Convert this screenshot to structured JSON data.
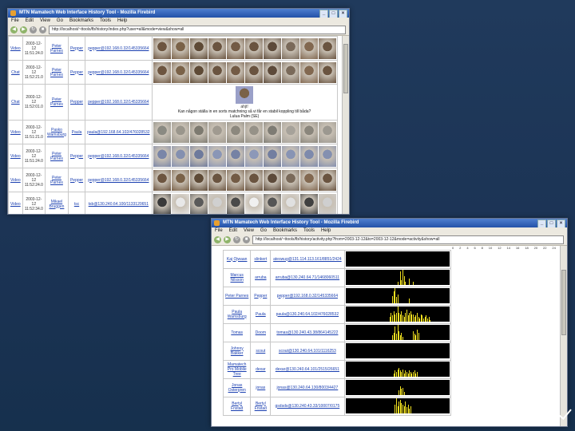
{
  "window1": {
    "title": "MTN Mamatech Web Interface History Tool - Mozilla Firebird",
    "menu": [
      "File",
      "Edit",
      "View",
      "Go",
      "Bookmarks",
      "Tools",
      "Help"
    ],
    "url": "http://localhost/~ttools/fb/history/index.php?user=all&mode=view&show=all",
    "rows": [
      {
        "type": "Video",
        "date": "2003-12-12 11:51:24.0",
        "user": "Peter Parnes",
        "host": "Pepper",
        "session": "pepper@192.168.0.32/145335664",
        "media": "thumbs",
        "thumb_colors": [
          "#6d5540",
          "#7a6248",
          "#5e4a36",
          "#6a5440",
          "#735b45",
          "#6a5440",
          "#5d4a3a",
          "#7a6a5a",
          "#826850",
          "#6a5440"
        ]
      },
      {
        "type": "Chat",
        "date": "2003-12-12 11:52:21.0",
        "user": "Peter Parnes",
        "host": "Pepper",
        "session": "pepper@192.168.0.32/145335664",
        "media": "thumbs",
        "thumb_colors": [
          "#6d5540",
          "#7a6248",
          "#5e4a36",
          "#6a5440",
          "#735b45",
          "#6a5440",
          "#5d4a3a",
          "#7a6a5a",
          "#826850",
          "#6a5440"
        ]
      },
      {
        "type": "Chat",
        "date": "2003-12-12 11:52:01.0",
        "user": "Peter Parnes",
        "host": "Pepper",
        "session": "pepper@192.168.0.32/145335664",
        "media": "chat",
        "chat_header": "ahjt!",
        "chat_text": "Kan någon ställa in en sorts matchning så vi får en stabil koppling till båda? Lulua Palm (SE)"
      },
      {
        "type": "Video",
        "date": "2003-12-12 11:51:21.0",
        "user": "Pasko Wamsburg",
        "host": "Paula",
        "session": "paula@192.168.64.102/476028532",
        "media": "thumbs",
        "thumb_colors": [
          "#8a8a82",
          "#9a968c",
          "#7d7a70",
          "#a09a90",
          "#8c887e",
          "#969288",
          "#7e7c74",
          "#a6a29a",
          "#8a867c",
          "#9c9890"
        ]
      },
      {
        "type": "Video",
        "date": "2003-12-12 11:51:24.0",
        "user": "Peter Parnes",
        "host": "Pepper",
        "session": "pepper@192.168.0.32/145335664",
        "media": "thumbs",
        "thumb_colors": [
          "#7a86a8",
          "#8490b0",
          "#6e7a9c",
          "#8a96b6",
          "#7682a4",
          "#8c98b8",
          "#727ea0",
          "#8894b4",
          "#7e8aac",
          "#8490b0"
        ]
      },
      {
        "type": "Video",
        "date": "2003-12-12 11:52:24.0",
        "user": "Peter Parnes",
        "host": "Pepper",
        "session": "pepper@192.168.0.32/145335664",
        "media": "thumbs",
        "thumb_colors": [
          "#6d5540",
          "#7a6248",
          "#5e4a36",
          "#6a5440",
          "#735b45",
          "#6a5440",
          "#5d4a3a",
          "#7a6a5a",
          "#826850",
          "#6a5440"
        ]
      },
      {
        "type": "Video",
        "date": "2003-12-12 11:52:34.0",
        "user": "Mikael Bruggen",
        "host": "tsc",
        "session": "tsb@130.240.64.100/1133120651",
        "media": "thumbs",
        "thumb_colors": [
          "#3a3a3a",
          "#e8e8e8",
          "#5a5a5a",
          "#d0d0d0",
          "#4a4a4a",
          "#f0f0f0",
          "#555555",
          "#e0e0e0",
          "#404040",
          "#cfcfcf"
        ]
      }
    ]
  },
  "window2": {
    "title": "MTN Mamatech Web Interface History Tool - Mozilla Firebird",
    "menu": [
      "File",
      "Edit",
      "View",
      "Go",
      "Bookmarks",
      "Tools",
      "Help"
    ],
    "url": "http://localhost/~ttools/fb/history/activity.php?from=2003-12-12&to=2003-12-12&mode=activity&show=all",
    "scale": [
      "0",
      "2",
      "4",
      "6",
      "8",
      "10",
      "12",
      "14",
      "16",
      "18",
      "20",
      "22",
      "24"
    ],
    "rows": [
      {
        "user": "Kaj Ojwaan",
        "host": "slinkert",
        "session": "ateswug@131.114.113.161/8851/2424",
        "activity": [
          0,
          0,
          0,
          0,
          0,
          0,
          0,
          0,
          0,
          0,
          0,
          0,
          0,
          0,
          0,
          0,
          0,
          0,
          0,
          0,
          0,
          0,
          0,
          0,
          0,
          0,
          0,
          0,
          0,
          0,
          0,
          0,
          0,
          0,
          0,
          0,
          0,
          0,
          0,
          0,
          0,
          0,
          0,
          0,
          0,
          0,
          0,
          0,
          0,
          0,
          0,
          0,
          0,
          0,
          0,
          0,
          0,
          0,
          0,
          0,
          0,
          0,
          0,
          0,
          0,
          0,
          0,
          0,
          0,
          0,
          0,
          0,
          0,
          0,
          0,
          0,
          0,
          0,
          0,
          0
        ]
      },
      {
        "user": "Marcus Nilsson",
        "host": "arruba",
        "session": "arruba@130.240.64.71/1468060511",
        "activity": [
          0,
          0,
          0,
          0,
          0,
          0,
          0,
          0,
          0,
          0,
          0,
          0,
          0,
          0,
          0,
          0,
          0,
          0,
          0,
          0,
          0,
          0,
          0,
          0,
          0,
          0,
          0,
          0,
          0,
          0,
          0,
          0,
          0,
          0,
          0,
          0,
          0,
          0,
          0,
          0,
          0.2,
          0,
          0.9,
          0.3,
          1,
          0.6,
          0.2,
          0,
          0,
          0.4,
          0,
          0,
          0.2,
          0,
          0,
          0,
          0,
          0,
          0,
          0,
          0,
          0,
          0,
          0,
          0,
          0,
          0,
          0,
          0,
          0,
          0,
          0,
          0,
          0,
          0,
          0,
          0,
          0,
          0,
          0
        ]
      },
      {
        "user": "Peter Parnes",
        "host": "Pepper",
        "session": "pepper@192.168.0.32/145335664",
        "activity": [
          0,
          0,
          0,
          0,
          0,
          0,
          0,
          0,
          0,
          0,
          0,
          0,
          0,
          0,
          0,
          0,
          0,
          0,
          0,
          0,
          0,
          0,
          0,
          0,
          0,
          0,
          0,
          0,
          0,
          0,
          0,
          0,
          0,
          0,
          0,
          0,
          0.5,
          0.8,
          1,
          0.4,
          0.6,
          0,
          0,
          0,
          0,
          0,
          0,
          0,
          0,
          0.3,
          0,
          0,
          0,
          0,
          0,
          0,
          0,
          0,
          0,
          0,
          0,
          0,
          0,
          0,
          0,
          0,
          0,
          0,
          0,
          0,
          0,
          0,
          0,
          0,
          0,
          0,
          0,
          0,
          0,
          0
        ]
      },
      {
        "user": "Paula Wamsburg",
        "host": "Paula",
        "session": "paula@130.240.64.102/476028532",
        "activity": [
          0,
          0,
          0,
          0,
          0,
          0,
          0,
          0,
          0,
          0,
          0,
          0,
          0,
          0,
          0,
          0,
          0,
          0,
          0,
          0,
          0,
          0,
          0,
          0,
          0,
          0,
          0,
          0,
          0,
          0,
          0,
          0,
          0,
          0,
          0.3,
          0.6,
          0.4,
          0.7,
          0.5,
          0.6,
          1,
          0.6,
          0.5,
          0.7,
          0.4,
          0.3,
          0.6,
          0.8,
          0.4,
          0.6,
          0.7,
          0.5,
          0.5,
          0.3,
          0.4,
          0.6,
          0.3,
          0.2,
          0.5,
          0.4,
          0.2,
          0.3,
          0.4,
          0.2,
          0.3,
          0.1,
          0,
          0,
          0,
          0,
          0,
          0,
          0,
          0,
          0,
          0,
          0,
          0,
          0,
          0
        ]
      },
      {
        "user": "Tomas",
        "host": "Doom",
        "session": "tomas@130.240.43.38/864145222",
        "activity": [
          0,
          0,
          0,
          0,
          0,
          0,
          0,
          0,
          0,
          0,
          0,
          0,
          0,
          0,
          0,
          0,
          0,
          0,
          0,
          0,
          0,
          0,
          0,
          0,
          0,
          0,
          0,
          0,
          0,
          0,
          0,
          0,
          0,
          0,
          0,
          0,
          0.3,
          0.5,
          0.9,
          0.4,
          1,
          0.6,
          0.3,
          0.5,
          0.2,
          0,
          0,
          0,
          0,
          0,
          0,
          0,
          0.6,
          0.4,
          0.3,
          0.7,
          0.5,
          0,
          0,
          0,
          0,
          0,
          0,
          0,
          0,
          0,
          0,
          0,
          0,
          0,
          0,
          0,
          0,
          0,
          0,
          0,
          0,
          0,
          0,
          0
        ]
      },
      {
        "user": "Johnny Bakker",
        "host": "scout",
        "session": "scout@130.240.64.101/1116253",
        "activity": [
          0,
          0,
          0,
          0,
          0,
          0,
          0,
          0,
          0,
          0,
          0,
          0,
          0,
          0,
          0,
          0,
          0,
          0,
          0,
          0,
          0,
          0,
          0,
          0,
          0,
          0,
          0,
          0,
          0,
          0,
          0,
          0,
          0,
          0,
          0,
          0,
          0,
          0,
          0,
          0,
          0,
          0,
          0,
          0,
          0,
          0,
          0,
          0,
          0,
          0,
          0,
          0,
          0,
          0,
          0,
          0,
          0,
          0,
          0,
          0,
          0,
          0,
          0,
          0,
          0,
          0,
          0,
          0,
          0,
          0,
          0,
          0,
          0,
          0,
          0,
          0,
          0,
          0,
          0,
          0
        ]
      },
      {
        "user": "Mamatech Pro Mobile Tree",
        "host": "dexar",
        "session": "dexar@130.240.64.101/2515/26651",
        "activity": [
          0,
          0,
          0,
          0,
          0,
          0,
          0,
          0,
          0,
          0,
          0,
          0,
          0,
          0,
          0,
          0,
          0,
          0,
          0,
          0,
          0,
          0,
          0,
          0,
          0,
          0,
          0,
          0,
          0,
          0,
          0,
          0,
          0,
          0,
          0,
          0,
          0,
          0.2,
          0.4,
          0.3,
          0.5,
          0.6,
          0.4,
          0.3,
          0.5,
          0.2,
          0.4,
          0.3,
          0.2,
          0.4,
          0.3,
          0.2,
          0.3,
          0.4,
          0.2,
          0.3,
          0,
          0,
          0,
          0,
          0,
          0,
          0,
          0,
          0,
          0,
          0,
          0,
          0,
          0,
          0,
          0,
          0,
          0,
          0,
          0,
          0,
          0,
          0,
          0
        ]
      },
      {
        "user": "Jonas Ostergren",
        "host": "jonas",
        "session": "jonas@130.240.64.130/8003/4427",
        "activity": [
          0,
          0,
          0,
          0,
          0,
          0,
          0,
          0,
          0,
          0,
          0,
          0,
          0,
          0,
          0,
          0,
          0,
          0,
          0,
          0,
          0,
          0,
          0,
          0,
          0,
          0,
          0,
          0,
          0,
          0,
          0,
          0,
          0,
          0,
          0,
          0,
          0,
          0,
          0,
          0,
          0,
          0.3,
          0.6,
          0.4,
          0.5,
          0.2,
          0,
          0,
          0,
          0,
          0,
          0,
          0,
          0,
          0,
          0,
          0,
          0,
          0,
          0,
          0,
          0,
          0,
          0,
          0,
          0,
          0,
          0,
          0,
          0,
          0,
          0,
          0,
          0,
          0,
          0,
          0,
          0,
          0,
          0
        ]
      },
      {
        "user": "Bertyl Fnstad",
        "host": "Bertyl Fnstad",
        "session": "gsdsds@130.240.43.33/10007/0175",
        "activity": [
          0,
          0,
          0,
          0,
          0,
          0,
          0,
          0,
          0,
          0,
          0,
          0,
          0,
          0,
          0,
          0,
          0,
          0,
          0,
          0,
          0,
          0,
          0,
          0,
          0,
          0,
          0,
          0,
          0,
          0,
          0,
          0,
          0,
          0,
          0,
          0,
          0,
          0,
          0.6,
          1,
          0.5,
          0.8,
          0.9,
          0.7,
          0.6,
          0.5,
          0.8,
          0.4,
          0.6,
          0.3,
          0.5,
          0,
          0,
          0,
          0,
          0,
          0,
          0,
          0,
          0,
          0,
          0,
          0,
          0,
          0,
          0,
          0,
          0,
          0,
          0,
          0,
          0,
          0,
          0,
          0,
          0,
          0,
          0,
          0,
          0
        ]
      }
    ]
  }
}
